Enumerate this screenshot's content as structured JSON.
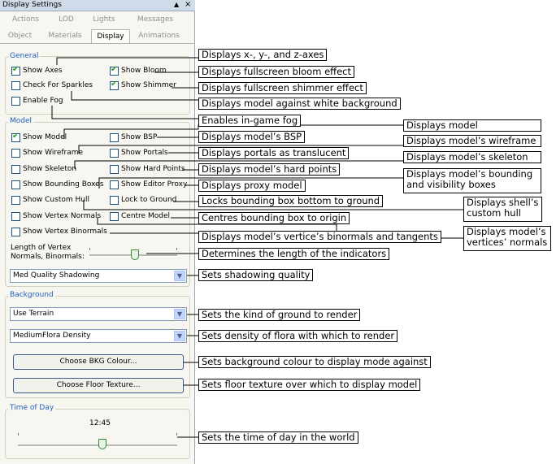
{
  "window": {
    "title": "Display Settings",
    "pin_icon": "pin-icon",
    "close_icon": "close-icon"
  },
  "tabs_row1": [
    {
      "label": "Actions"
    },
    {
      "label": "LOD"
    },
    {
      "label": "Lights"
    },
    {
      "label": "Messages"
    }
  ],
  "tabs_row2": [
    {
      "label": "Object"
    },
    {
      "label": "Materials"
    },
    {
      "label": "Display",
      "selected": true
    },
    {
      "label": "Animations"
    }
  ],
  "general": {
    "label": "General",
    "show_axes": {
      "label": "Show Axes",
      "checked": true
    },
    "show_bloom": {
      "label": "Show Bloom",
      "checked": true
    },
    "check_sparkles": {
      "label": "Check For Sparkles",
      "checked": false
    },
    "show_shimmer": {
      "label": "Show Shimmer",
      "checked": true
    },
    "enable_fog": {
      "label": "Enable Fog",
      "checked": false
    }
  },
  "model": {
    "label": "Model",
    "show_model": {
      "label": "Show Model",
      "checked": true
    },
    "show_bsp": {
      "label": "Show BSP",
      "checked": false
    },
    "show_wireframe": {
      "label": "Show Wireframe",
      "checked": false
    },
    "show_portals": {
      "label": "Show Portals",
      "checked": false
    },
    "show_skeleton": {
      "label": "Show Skeleton",
      "checked": false
    },
    "show_hard_points": {
      "label": "Show Hard Points",
      "checked": false
    },
    "show_bounding_boxes": {
      "label": "Show Bounding Boxes",
      "checked": false
    },
    "show_editor_proxy": {
      "label": "Show Editor Proxy",
      "checked": false
    },
    "show_custom_hull": {
      "label": "Show Custom Hull",
      "checked": false
    },
    "lock_to_ground": {
      "label": "Lock to Ground",
      "checked": false
    },
    "show_vertex_normals": {
      "label": "Show Vertex Normals",
      "checked": false
    },
    "centre_model": {
      "label": "Centre Model",
      "checked": false
    },
    "show_vertex_binormals": {
      "label": "Show Vertex Binormals",
      "checked": false
    },
    "length_label_1": "Length of Vertex",
    "length_label_2": "Normals, Binormals:",
    "length_slider_fraction": 0.52,
    "shadowing_value": "Med Quality Shadowing"
  },
  "background": {
    "label": "Background",
    "terrain_value": "Use Terrain",
    "flora_value": "MediumFlora Density",
    "bkg_colour_button": "Choose BKG Colour...",
    "floor_texture_button": "Choose Floor Texture..."
  },
  "time_of_day": {
    "label": "Time of Day",
    "value": "12:45",
    "slider_fraction": 0.53
  },
  "annotations": {
    "axes": "Displays x-, y-, and z-axes",
    "bloom": "Displays fullscreen bloom effect",
    "shimmer": "Displays fullscreen shimmer effect",
    "sparkles": "Displays model against white background",
    "fog": "Enables in-game fog",
    "model": "Displays model",
    "bsp": "Displays model’s BSP",
    "wireframe": "Displays model’s wireframe",
    "portals": "Displays portals as translucent",
    "skeleton": "Displays model’s skeleton",
    "hard_points": "Displays model’s hard points",
    "bounding": "Displays model’s bounding and visibility boxes",
    "proxy": "Displays proxy model",
    "lock_ground": "Locks bounding box bottom to ground",
    "custom_hull": "Displays shell’s custom hull",
    "centre": "Centres bounding box to origin",
    "normals": "Displays model’s vertices’ normals",
    "binormals": "Displays model’s vertice’s binormals and tangents",
    "length": "Determines the length of the indicators",
    "shadowing": "Sets shadowing quality",
    "ground": "Sets the kind of ground to render",
    "flora": "Sets density of flora with which to render",
    "bkg_colour": "Sets background colour to display mode against",
    "floor": "Sets floor texture over which to display model",
    "time": "Sets the time of day in the world"
  }
}
